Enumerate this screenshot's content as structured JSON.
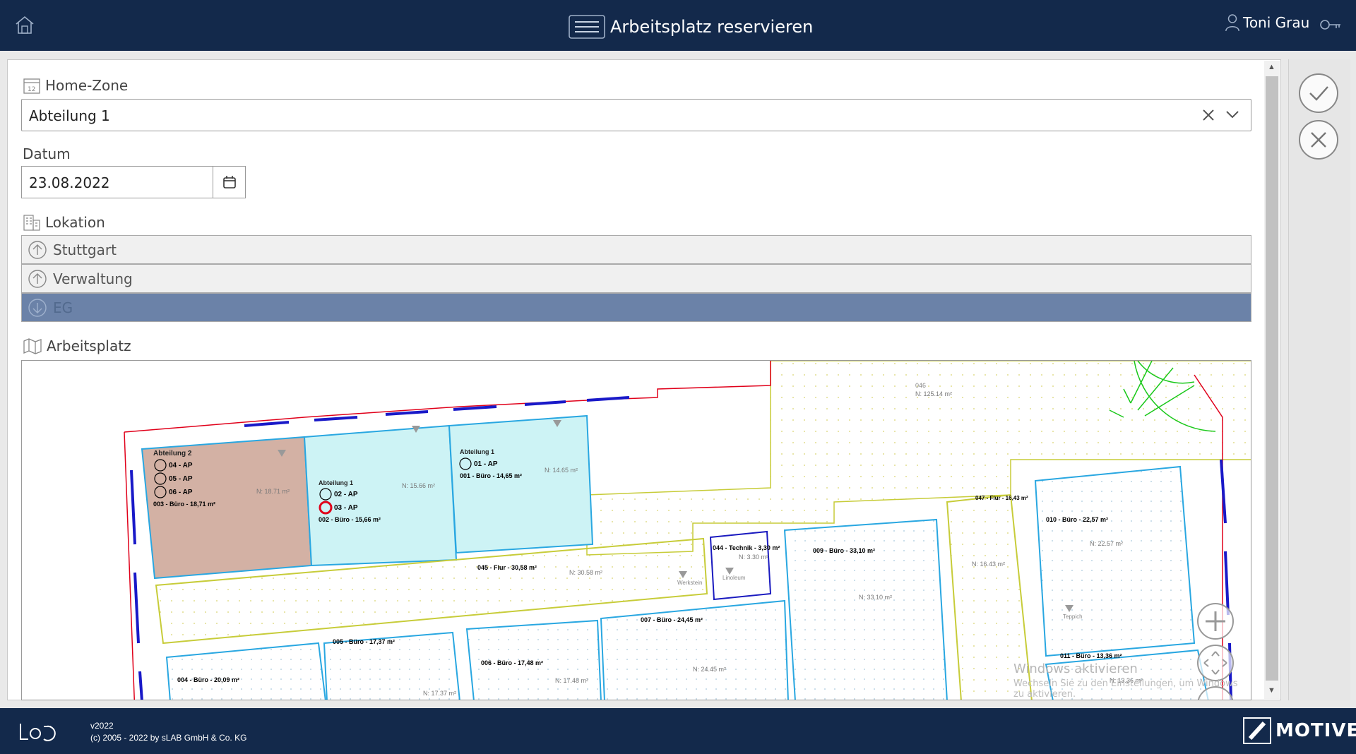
{
  "header": {
    "title": "Arbeitsplatz reservieren",
    "user_name": "Toni Grau"
  },
  "form": {
    "home_zone": {
      "label": "Home-Zone",
      "value": "Abteilung 1"
    },
    "datum": {
      "label": "Datum",
      "value": "23.08.2022"
    },
    "lokation": {
      "label": "Lokation",
      "items": [
        {
          "label": "Stuttgart",
          "icon": "arrow-up-circle-icon"
        },
        {
          "label": "Verwaltung",
          "icon": "arrow-up-circle-icon"
        },
        {
          "label": "EG",
          "icon": "arrow-down-circle-icon",
          "selected": true
        }
      ]
    },
    "arbeitsplatz": {
      "label": "Arbeitsplatz"
    }
  },
  "floorplan": {
    "zones": [
      {
        "name": "Abteilung 2",
        "color": "#d3b1a4"
      },
      {
        "name": "Abteilung 1",
        "color": "#cdf3f5"
      }
    ],
    "workplaces": [
      "04 - AP",
      "05 - AP",
      "06 - AP",
      "02 - AP",
      "03 - AP",
      "01 - AP"
    ],
    "selected_workplace": "03 - AP",
    "rooms": [
      {
        "label": "003 - Büro - 18,71 m²",
        "area": "N: 18.71 m²",
        "num": "003"
      },
      {
        "label": "002 - Büro - 15,66 m²",
        "area": "N: 15.66 m²",
        "num": "002"
      },
      {
        "label": "001 - Büro - 14,65 m²",
        "area": "N: 14.65 m²",
        "num": "001"
      },
      {
        "label": "045 - Flur - 30,58 m²",
        "area": "N: 30.58 m²",
        "num": "045"
      },
      {
        "label": "044 - Technik - 3,30 m²",
        "area": "N: 3.30 m²",
        "num": ""
      },
      {
        "label": "009 - Büro - 33,10 m²",
        "area": "N: 33.10 m²",
        "num": "009"
      },
      {
        "label": "047 - Flur - 16,43 m²",
        "area": "N: 16.43 m²",
        "num": "047"
      },
      {
        "label": "010 - Büro - 22,57 m²",
        "area": "N: 22.57 m²",
        "num": "010"
      },
      {
        "label": "011 - Büro - 13,36 m²",
        "area": "N: 13.36 m²",
        "num": "011"
      },
      {
        "label": "007 - Büro - 24,45 m²",
        "area": "N: 24.45 m²",
        "num": "007"
      },
      {
        "label": "006 - Büro - 17,48 m²",
        "area": "N: 17.48 m²",
        "num": "006"
      },
      {
        "label": "005 - Büro - 17,37 m²",
        "area": "N: 17.37 m²",
        "num": "005"
      },
      {
        "label": "004 - Büro - 20,09 m²",
        "area": "",
        "num": "004"
      }
    ],
    "hall": {
      "num": "046",
      "area": "N: 125.14 m²"
    },
    "materials": {
      "carpet": "Teppich",
      "stone": "Werkstein",
      "linoleum": "Linoleum"
    },
    "watermark_title": "Windows aktivieren",
    "watermark_sub": "Wechseln Sie zu den Einstellungen, um Windows zu aktivieren."
  },
  "footer": {
    "version": "v2022",
    "copyright": "(c) 2005 - 2022 by sLAB GmbH & Co. KG",
    "brand": "MOTIVE"
  },
  "colors": {
    "header_bg": "#13294b",
    "selected_location_bg": "#6b82a8",
    "zone_abteilung_2": "#d3b1a4",
    "zone_abteilung_1": "#cdf3f5",
    "room_outline": "#29a7e1",
    "wall_red": "#e0001a"
  }
}
